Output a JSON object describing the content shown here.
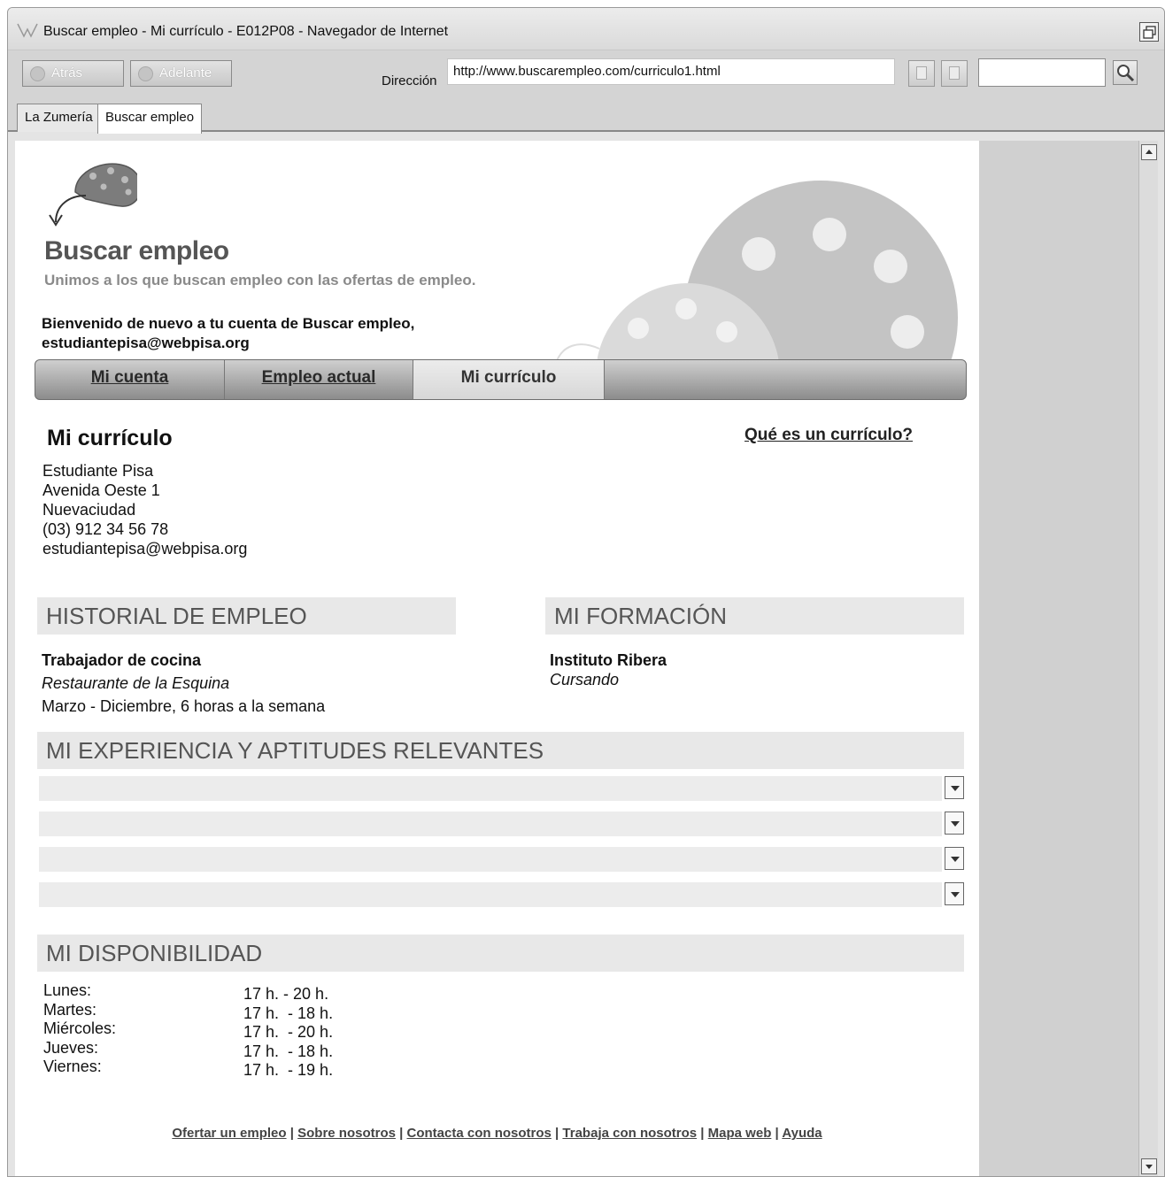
{
  "window": {
    "title": "Buscar empleo - Mi currículo - E012P08 - Navegador de Internet"
  },
  "toolbar": {
    "back_label": "Atrás",
    "forward_label": "Adelante",
    "address_label": "Dirección",
    "address_value": "http://www.buscarempleo.com/curriculo1.html",
    "search_value": ""
  },
  "tabs": [
    {
      "label": "La Zumería"
    },
    {
      "label": "Buscar empleo"
    }
  ],
  "site": {
    "title": "Buscar empleo",
    "tagline": "Unimos a los que buscan empleo con las ofertas de empleo.",
    "welcome_line1": "Bienvenido de nuevo a tu cuenta de Buscar empleo,",
    "welcome_line2": "estudiantepisa@webpisa.org"
  },
  "nav": {
    "items": [
      {
        "label": "Mi cuenta"
      },
      {
        "label": "Empleo actual"
      },
      {
        "label": "Mi currículo"
      }
    ],
    "active": "Mi currículo"
  },
  "resume": {
    "heading": "Mi currículo",
    "help_link": "Qué es un currículo?",
    "contact": {
      "name": "Estudiante Pisa",
      "street": "Avenida Oeste 1",
      "city": "Nuevaciudad",
      "phone": "(03) 912 34 56 78",
      "email": "estudiantepisa@webpisa.org"
    },
    "employment": {
      "heading": "HISTORIAL DE EMPLEO",
      "job_title": "Trabajador de cocina",
      "company": "Restaurante de la Esquina",
      "period": "Marzo - Diciembre, 6 horas a la semana"
    },
    "education": {
      "heading": "MI FORMACIÓN",
      "school": "Instituto Ribera",
      "status": "Cursando"
    },
    "experience": {
      "heading": "MI EXPERIENCIA Y APTITUDES RELEVANTES",
      "dropdowns": [
        "",
        "",
        "",
        ""
      ]
    },
    "availability": {
      "heading": "MI DISPONIBILIDAD",
      "days": [
        "Lunes:",
        "Martes:",
        "Miércoles:",
        "Jueves:",
        "Viernes:"
      ],
      "hours": [
        "17 h. - 20 h.",
        "17 h.  - 18 h.",
        "17 h.  - 20 h.",
        "17 h.  - 18 h.",
        "17 h.  - 19 h."
      ]
    }
  },
  "footer": {
    "links": [
      "Ofertar un empleo",
      "Sobre nosotros",
      "Contacta con nosotros",
      "Trabaja con nosotros",
      "Mapa web",
      "Ayuda"
    ],
    "separator": " | "
  },
  "icons": {
    "window_logo": "browser-logo-icon",
    "restore": "restore-window-icon",
    "back": "back-arrow-icon",
    "forward": "forward-arrow-icon",
    "copy": "copy-icon",
    "paste": "paste-icon",
    "search": "magnifier-icon",
    "dropdown": "chevron-down-icon",
    "scroll_up": "scroll-up-icon",
    "scroll_down": "scroll-down-icon"
  }
}
